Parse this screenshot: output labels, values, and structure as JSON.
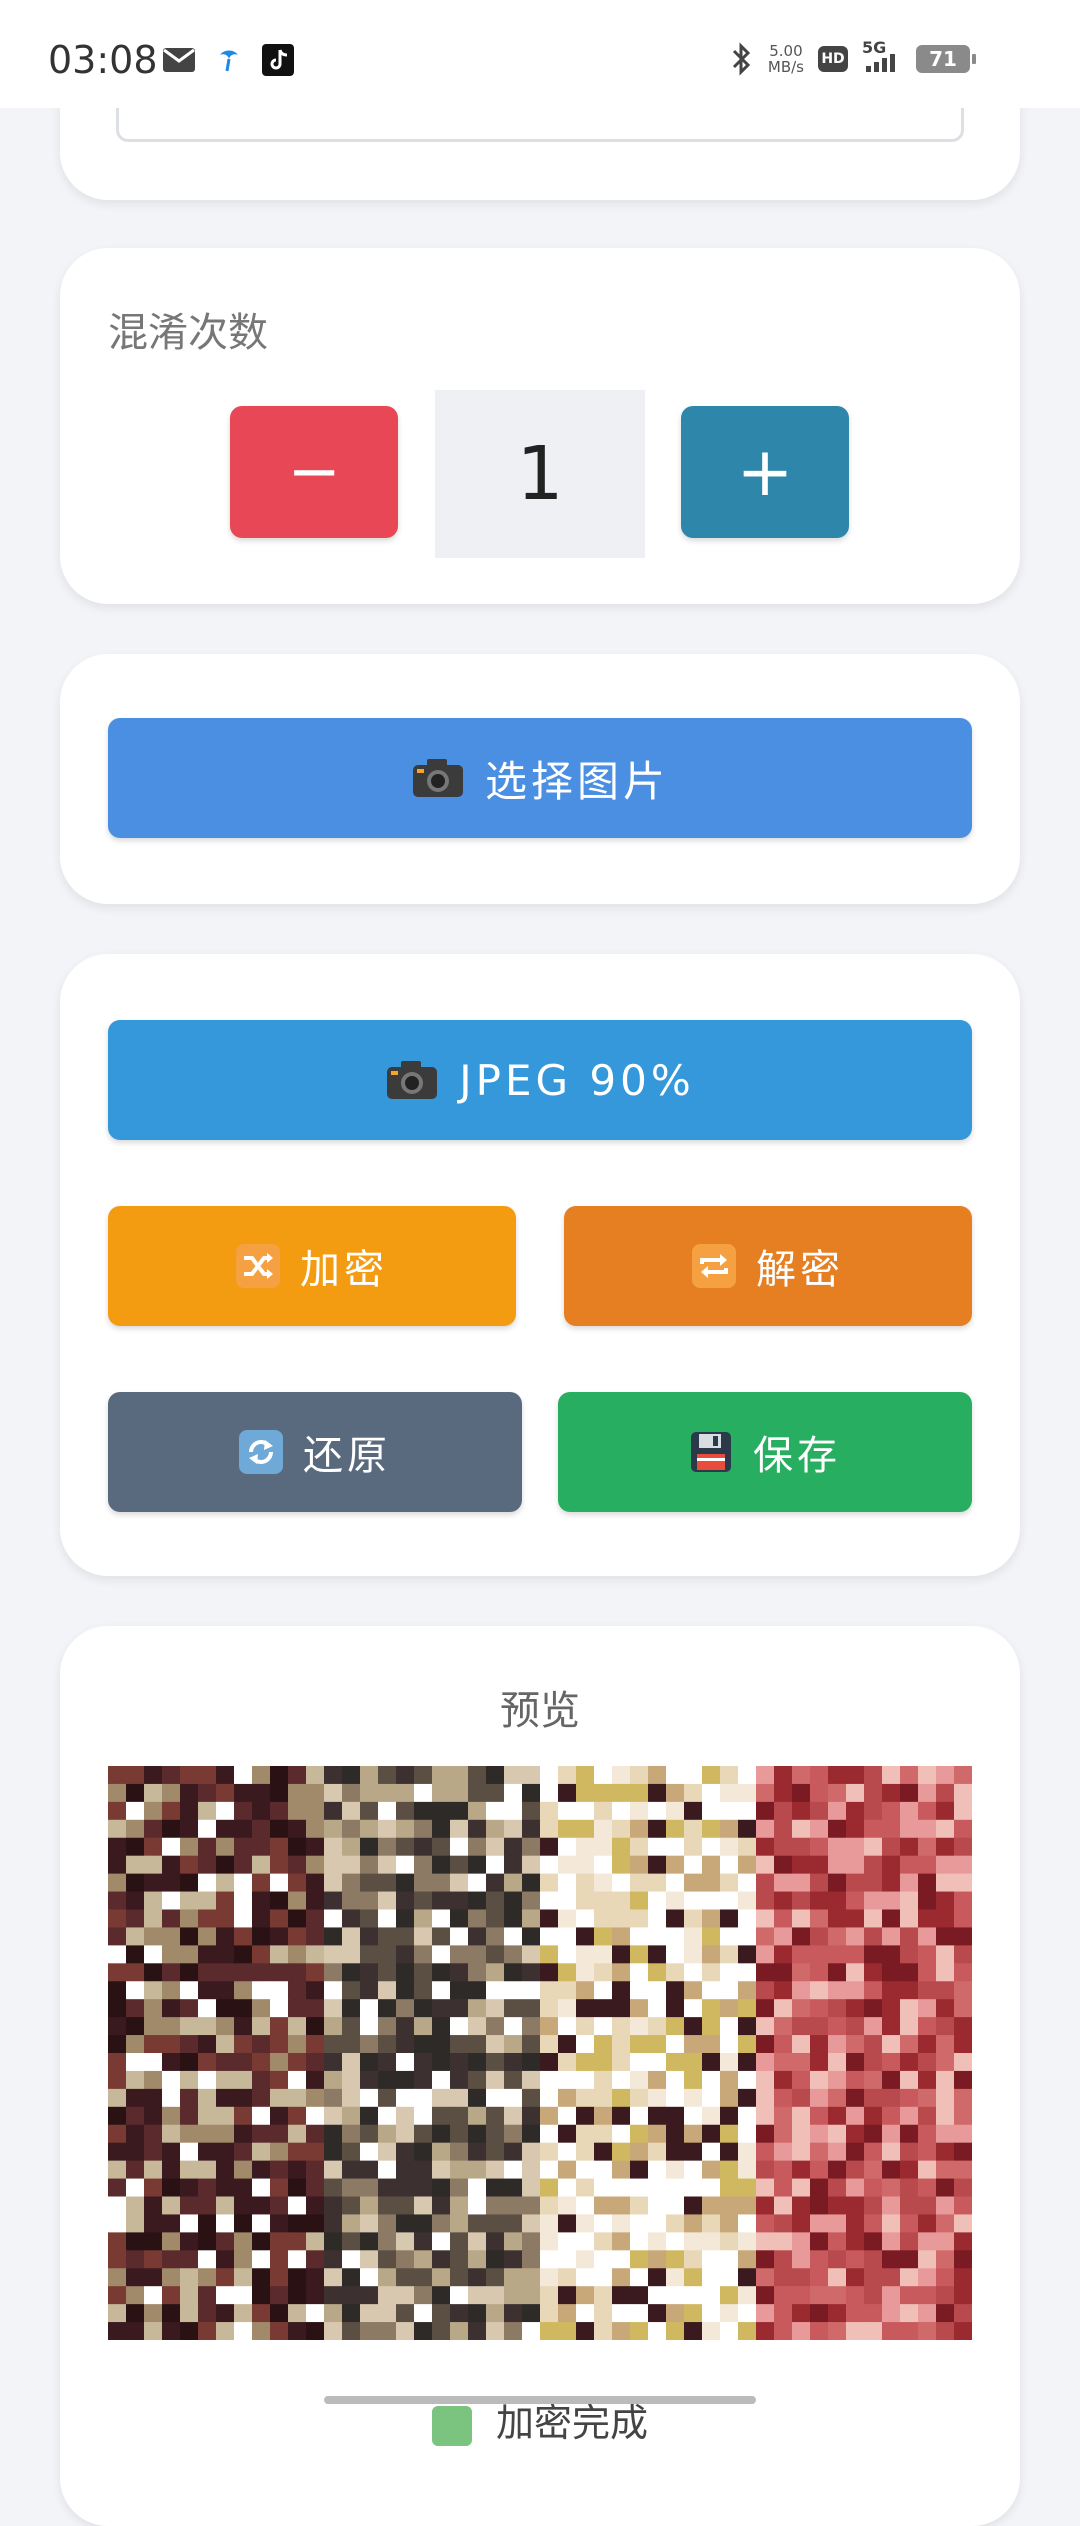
{
  "status_bar": {
    "time": "03:08",
    "network_speed_value": "5.00",
    "network_speed_unit": "MB/s",
    "hd_label": "HD",
    "signal_label": "5G",
    "battery_level": "71",
    "icons": [
      "mail-icon",
      "app-icon",
      "tiktok-icon",
      "bluetooth-icon",
      "hd-icon",
      "signal-5g-icon",
      "battery-icon"
    ]
  },
  "obfuscation": {
    "label": "混淆次数",
    "count": "1",
    "minus_label": "−",
    "plus_label": "+"
  },
  "select": {
    "label": "选择图片",
    "icon": "camera-icon"
  },
  "actions": {
    "jpeg_label": "JPEG 90%",
    "encrypt_label": "加密",
    "decrypt_label": "解密",
    "restore_label": "还原",
    "save_label": "保存"
  },
  "preview": {
    "title": "预览",
    "status": "加密完成"
  },
  "colors": {
    "minus": "#e84855",
    "plus": "#2e86ab",
    "select": "#4a8fe2",
    "jpeg": "#3498db",
    "encrypt": "#f39c12",
    "decrypt": "#e67e22",
    "restore": "#5a6a7e",
    "save": "#27ae60"
  }
}
